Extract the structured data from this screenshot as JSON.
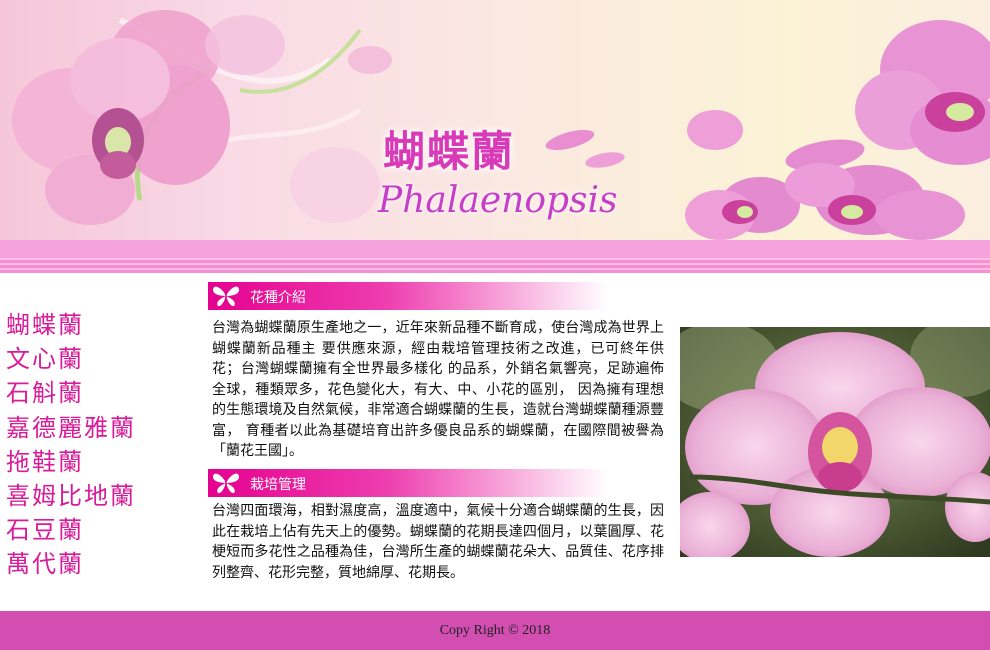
{
  "banner": {
    "title_cn": "蝴蝶蘭",
    "title_en": "Phalaenopsis"
  },
  "nav": {
    "items": [
      "蝴蝶蘭",
      "文心蘭",
      "石斛蘭",
      "嘉德麗雅蘭",
      "拖鞋蘭",
      "喜姆比地蘭",
      "石豆蘭",
      "萬代蘭"
    ]
  },
  "sections": [
    {
      "heading": "花種介紹",
      "body": "台灣為蝴蝶蘭原生產地之一，近年來新品種不斷育成，使台灣成為世界上蝴蝶蘭新品種主 要供應來源，經由栽培管理技術之改進，已可終年供花；台灣蝴蝶蘭擁有全世界最多樣化 的品系，外銷名氣響亮，足跡遍佈全球，種類眾多，花色變化大，有大、中、小花的區別， 因為擁有理想的生態環境及自然氣候，非常適合蝴蝶蘭的生長，造就台灣蝴蝶蘭種源豐富， 育種者以此為基礎培育出許多優良品系的蝴蝶蘭，在國際間被譽為「蘭花王國」。"
    },
    {
      "heading": "栽培管理",
      "body": "台灣四面環海，相對濕度高，溫度適中，氣候十分適合蝴蝶蘭的生長，因此在栽培上佔有先天上的優勢。蝴蝶蘭的花期長達四個月，以葉圓厚、花梗短而多花性之品種為佳，台灣所生產的蝴蝶蘭花朵大、品質佳、花序排列整齊、花形完整，質地綿厚、花期長。"
    }
  ],
  "footer": {
    "text": "Copy Right © 2018"
  },
  "colors": {
    "accent": "#d81b9a",
    "footer_bg": "#d34eb1",
    "section_bar": "#e5008f"
  },
  "icons": {
    "section_icon": "butterfly-icon"
  }
}
